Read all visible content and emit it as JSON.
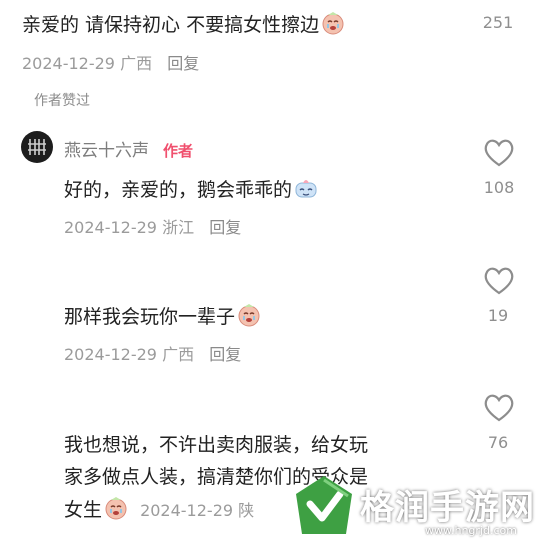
{
  "comment1": {
    "text": "亲爱的 请保持初心 不要搞女性擦边",
    "date": "2024-12-29",
    "location": "广西",
    "reply_label": "回复",
    "likes": "251"
  },
  "author_liked_label": "作者赞过",
  "comment2": {
    "name": "燕云十六声",
    "author_badge": "作者",
    "text": "好的，亲爱的，鹅会乖乖的",
    "date": "2024-12-29",
    "location": "浙江",
    "reply_label": "回复",
    "likes": "108"
  },
  "comment3": {
    "text": "那样我会玩你一辈子",
    "date": "2024-12-29",
    "location": "广西",
    "reply_label": "回复",
    "likes": "19"
  },
  "comment4": {
    "line1": "我也想说，不许出卖肉服装，给女玩",
    "line2": "家多做点人装，搞清楚你们的受众是",
    "line3": "女生",
    "date": "2024-12-29",
    "location": "陕",
    "likes": "76"
  },
  "watermark": {
    "text": "格润手游网",
    "url": "www.hngrjd.com"
  },
  "colors": {
    "author_badge": "#f0506e",
    "watermark_green": "#3ea043"
  }
}
